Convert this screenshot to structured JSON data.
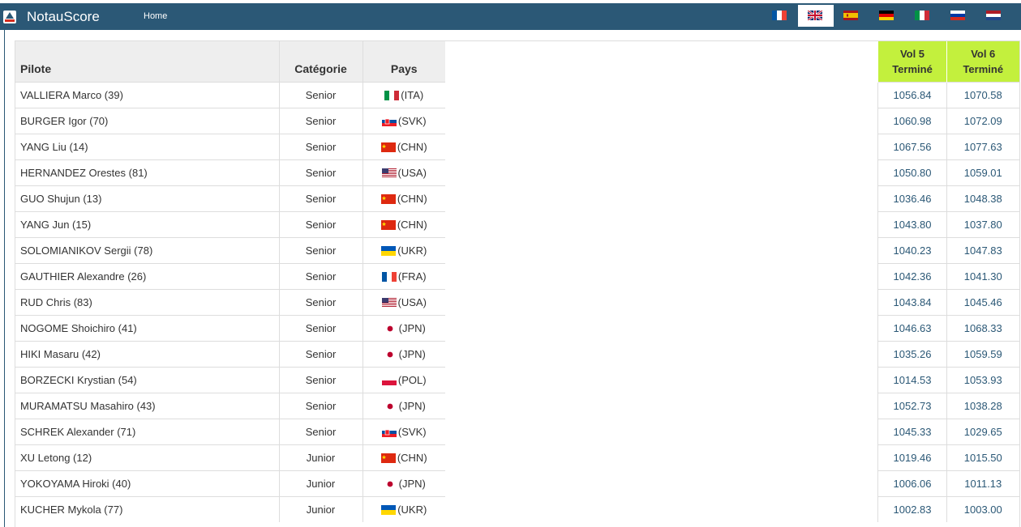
{
  "nav": {
    "brand": "NotauScore",
    "home": "Home",
    "languages": [
      {
        "icon": "flag-france-icon",
        "active": false
      },
      {
        "icon": "flag-uk-icon",
        "active": true
      },
      {
        "icon": "flag-spain-icon",
        "active": false
      },
      {
        "icon": "flag-germany-icon",
        "active": false
      },
      {
        "icon": "flag-italy-icon",
        "active": false
      },
      {
        "icon": "flag-russia-icon",
        "active": false
      },
      {
        "icon": "flag-netherlands-icon",
        "active": false
      }
    ]
  },
  "table": {
    "headers": {
      "pilot": "Pilote",
      "category": "Catégorie",
      "country": "Pays"
    },
    "score_headers": [
      {
        "line1": "Vol 5",
        "line2": "Terminé"
      },
      {
        "line1": "Vol 6",
        "line2": "Terminé"
      }
    ],
    "accent_color": "#c3f03d",
    "rows": [
      {
        "pilot": "VALLIERA Marco (39)",
        "category": "Senior",
        "country": "(ITA)",
        "flag": "ITA",
        "vol5": "1056.84",
        "vol6": "1070.58"
      },
      {
        "pilot": "BURGER Igor (70)",
        "category": "Senior",
        "country": "(SVK)",
        "flag": "SVK",
        "vol5": "1060.98",
        "vol6": "1072.09"
      },
      {
        "pilot": "YANG Liu (14)",
        "category": "Senior",
        "country": "(CHN)",
        "flag": "CHN",
        "vol5": "1067.56",
        "vol6": "1077.63"
      },
      {
        "pilot": "HERNANDEZ Orestes (81)",
        "category": "Senior",
        "country": "(USA)",
        "flag": "USA",
        "vol5": "1050.80",
        "vol6": "1059.01"
      },
      {
        "pilot": "GUO Shujun (13)",
        "category": "Senior",
        "country": "(CHN)",
        "flag": "CHN",
        "vol5": "1036.46",
        "vol6": "1048.38"
      },
      {
        "pilot": "YANG Jun (15)",
        "category": "Senior",
        "country": "(CHN)",
        "flag": "CHN",
        "vol5": "1043.80",
        "vol6": "1037.80"
      },
      {
        "pilot": "SOLOMIANIKOV Sergii (78)",
        "category": "Senior",
        "country": "(UKR)",
        "flag": "UKR",
        "vol5": "1040.23",
        "vol6": "1047.83"
      },
      {
        "pilot": "GAUTHIER Alexandre (26)",
        "category": "Senior",
        "country": "(FRA)",
        "flag": "FRA",
        "vol5": "1042.36",
        "vol6": "1041.30"
      },
      {
        "pilot": "RUD Chris (83)",
        "category": "Senior",
        "country": "(USA)",
        "flag": "USA",
        "vol5": "1043.84",
        "vol6": "1045.46"
      },
      {
        "pilot": "NOGOME Shoichiro (41)",
        "category": "Senior",
        "country": "(JPN)",
        "flag": "JPN",
        "vol5": "1046.63",
        "vol6": "1068.33"
      },
      {
        "pilot": "HIKI Masaru (42)",
        "category": "Senior",
        "country": "(JPN)",
        "flag": "JPN",
        "vol5": "1035.26",
        "vol6": "1059.59"
      },
      {
        "pilot": "BORZECKI Krystian (54)",
        "category": "Senior",
        "country": "(POL)",
        "flag": "POL",
        "vol5": "1014.53",
        "vol6": "1053.93"
      },
      {
        "pilot": "MURAMATSU Masahiro (43)",
        "category": "Senior",
        "country": "(JPN)",
        "flag": "JPN",
        "vol5": "1052.73",
        "vol6": "1038.28"
      },
      {
        "pilot": "SCHREK Alexander (71)",
        "category": "Senior",
        "country": "(SVK)",
        "flag": "SVK",
        "vol5": "1045.33",
        "vol6": "1029.65"
      },
      {
        "pilot": "XU Letong (12)",
        "category": "Junior",
        "country": "(CHN)",
        "flag": "CHN",
        "vol5": "1019.46",
        "vol6": "1015.50"
      },
      {
        "pilot": "YOKOYAMA Hiroki (40)",
        "category": "Junior",
        "country": "(JPN)",
        "flag": "JPN",
        "vol5": "1006.06",
        "vol6": "1011.13"
      },
      {
        "pilot": "KUCHER Mykola (77)",
        "category": "Junior",
        "country": "(UKR)",
        "flag": "UKR",
        "vol5": "1002.83",
        "vol6": "1003.00"
      }
    ]
  }
}
